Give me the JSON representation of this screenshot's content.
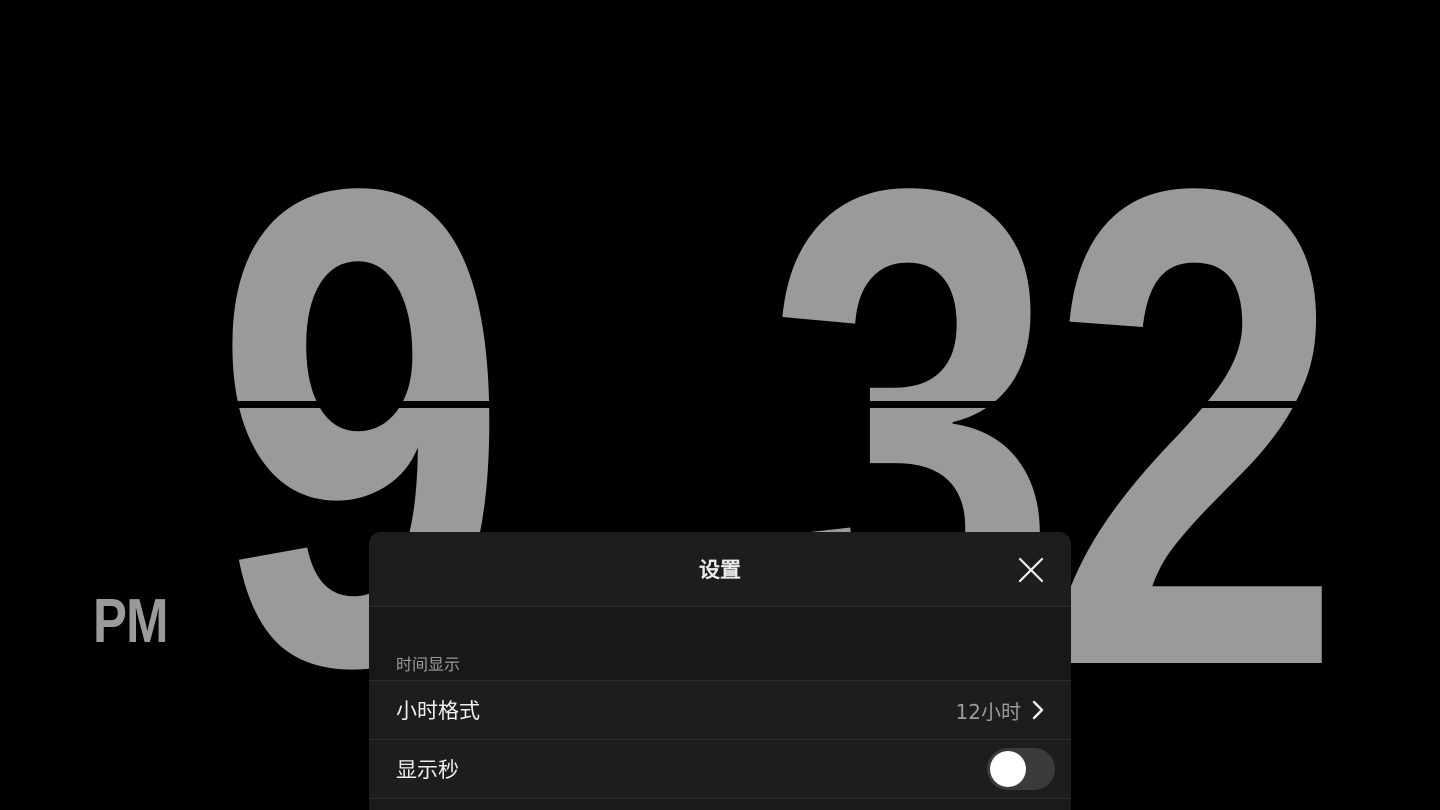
{
  "clock": {
    "hour": "9",
    "minute_tens": "3",
    "minute_ones": "2",
    "ampm": "PM"
  },
  "settings": {
    "title": "设置",
    "section_time_display": "时间显示",
    "hour_format": {
      "label": "小时格式",
      "value": "12小时"
    },
    "show_seconds": {
      "label": "显示秒",
      "enabled": false
    }
  },
  "colors": {
    "background": "#000000",
    "digit": "#9a9a9a",
    "panel": "#1b1b1b",
    "toggle_off": "#3b3b3b"
  },
  "icons": {
    "close": "close-icon",
    "chevron": "chevron-right-icon"
  }
}
